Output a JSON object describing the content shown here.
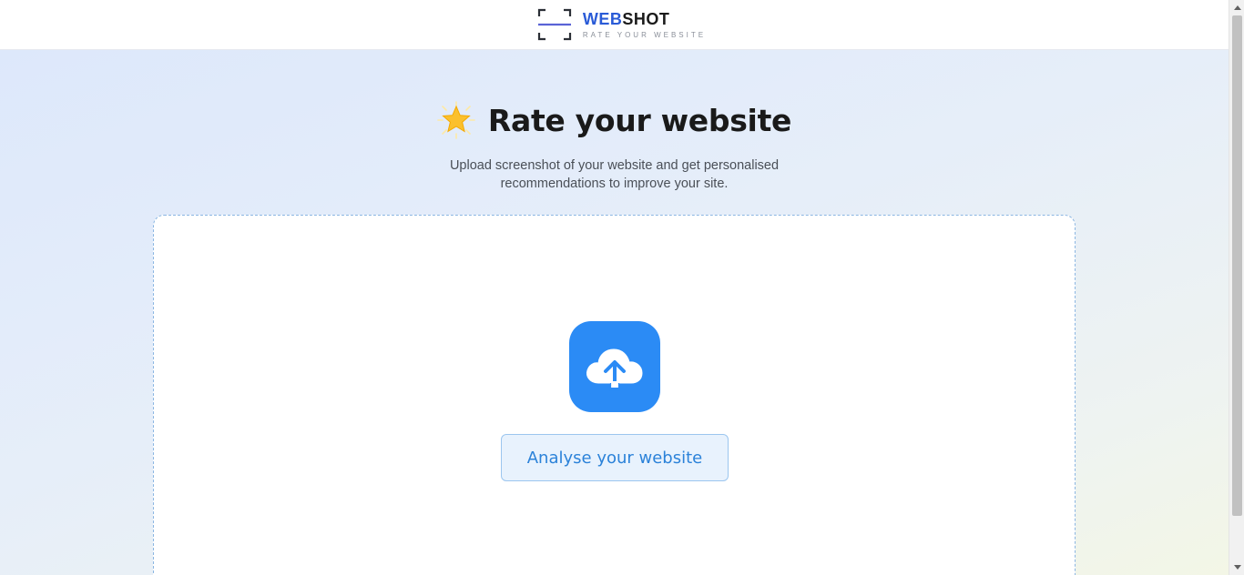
{
  "header": {
    "logo_word_blue": "WEB",
    "logo_word_dark": "SHOT",
    "logo_tagline": "RATE YOUR WEBSITE",
    "logo_icon": "viewfinder-icon"
  },
  "hero": {
    "title_icon": "glowing-star-icon",
    "title": "Rate your website",
    "subtitle_line1": "Upload screenshot of your website and get personalised",
    "subtitle_line2": "recommendations to improve your site."
  },
  "dropzone": {
    "icon": "cloud-upload-icon",
    "button_label": "Analyse your website"
  },
  "colors": {
    "accent": "#2b8bf5",
    "brand_blue": "#2a5bd7",
    "button_bg": "#e8f2fd",
    "button_text": "#2b82d9"
  }
}
